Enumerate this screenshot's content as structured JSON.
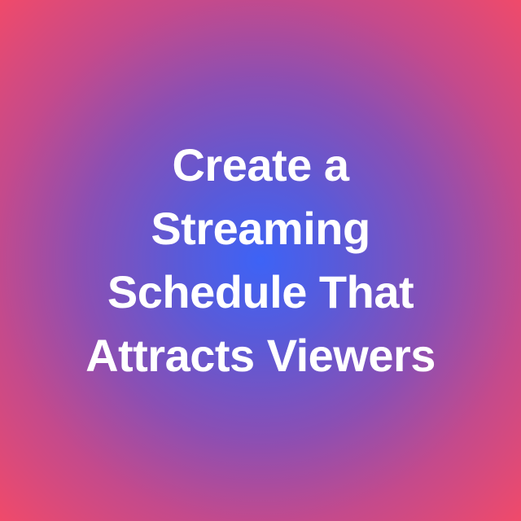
{
  "headline": {
    "lines": [
      "Create a",
      "Streaming",
      "Schedule That",
      "Attracts Viewers"
    ]
  },
  "colors": {
    "text": "#ffffff",
    "gradient_center": "#3d63f6",
    "gradient_edge": "#f04a6a"
  }
}
